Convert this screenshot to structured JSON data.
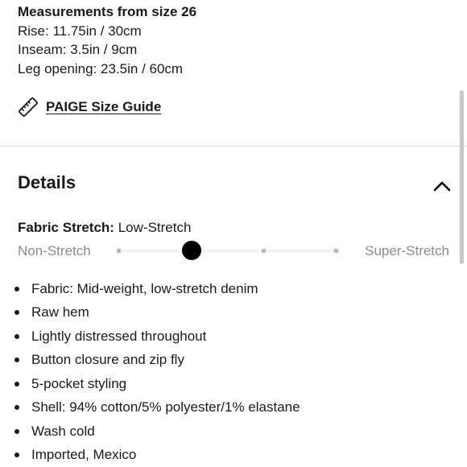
{
  "measurements": {
    "title": "Measurements from size 26",
    "lines": [
      "Rise: 11.75in / 30cm",
      "Inseam: 3.5in / 9cm",
      "Leg opening: 23.5in / 60cm"
    ]
  },
  "size_guide": {
    "icon": "ruler-icon",
    "label": "PAIGE Size Guide"
  },
  "details": {
    "title": "Details",
    "toggle_icon": "chevron-up-icon",
    "stretch": {
      "label": "Fabric Stretch:",
      "value": "Low-Stretch",
      "min_label": "Non-Stretch",
      "max_label": "Super-Stretch",
      "level": 0.33
    },
    "bullets": [
      "Fabric: Mid-weight, low-stretch denim",
      "Raw hem",
      "Lightly distressed throughout",
      "Button closure and zip fly",
      "5-pocket styling",
      "Shell: 94% cotton/5% polyester/1% elastane",
      "Wash cold",
      "Imported, Mexico"
    ]
  }
}
